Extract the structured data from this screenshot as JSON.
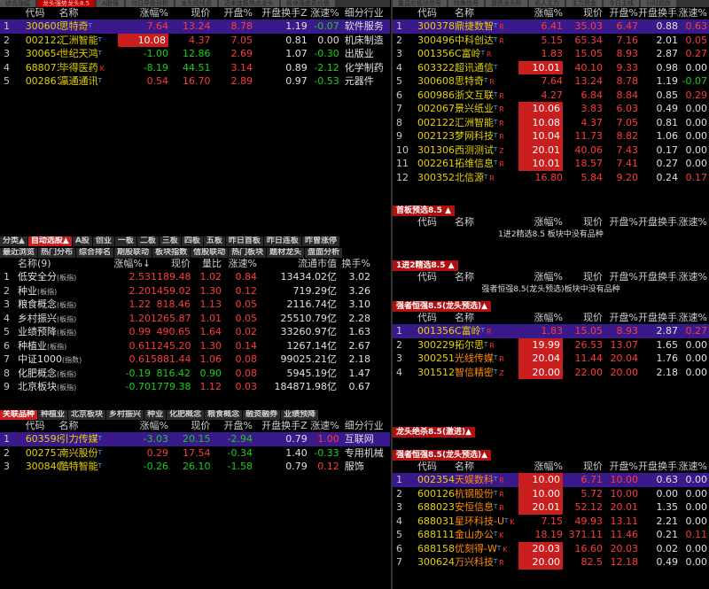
{
  "top_tabs_left": [
    "综合涨幅",
    "龙头强势龙头8.5",
    "A股强",
    "乌日早盘分析",
    "龙头短线盘",
    "近来连板热点龙头",
    "板块强盛竞价盘"
  ],
  "top_tabs_right": [
    "量益应板块信号",
    "特殊信号",
    "游资龙头阶",
    "毛人主力",
    "主力资金",
    "今日主线",
    "分时超跌"
  ],
  "hdr_main": {
    "code": "代码",
    "name": "名称",
    "chg": "涨幅%",
    "price": "现价",
    "open": "开盘%",
    "turn": "开盘换手Z",
    "spd": "涨速%",
    "ind": "细分行业"
  },
  "tl_rows": [
    {
      "i": "1",
      "code": "300608",
      "name": "思特奇",
      "chg": "7.64",
      "price": "13.24",
      "open": "8.78",
      "turn": "1.19",
      "spd": "-0.07",
      "ind": "软件服务",
      "sel": true
    },
    {
      "i": "2",
      "code": "002122",
      "name": "汇洲智能",
      "chg": "10.08",
      "price": "4.37",
      "open": "7.05",
      "turn": "0.81",
      "spd": "0.00",
      "ind": "机床制造",
      "hl": true
    },
    {
      "i": "3",
      "code": "300654",
      "name": "世纪天鸿",
      "chg": "-1.00",
      "price": "12.86",
      "open": "2.69",
      "turn": "1.07",
      "spd": "-0.30",
      "ind": "出版业"
    },
    {
      "i": "4",
      "code": "688073",
      "name": "毕得医药",
      "chg": "-8.19",
      "price": "44.51",
      "open": "3.14",
      "turn": "0.89",
      "spd": "-2.12",
      "ind": "化学制药",
      "tag": "K"
    },
    {
      "i": "5",
      "code": "002861",
      "name": "瀛通通讯",
      "chg": "0.54",
      "price": "16.70",
      "open": "2.89",
      "turn": "0.97",
      "spd": "-0.53",
      "ind": "元器件"
    }
  ],
  "tr_rows": [
    {
      "i": "1",
      "code": "300378",
      "name": "鼎捷数智",
      "tag": "R",
      "chg": "6.41",
      "price": "35.03",
      "open": "6.47",
      "turn": "0.88",
      "spd": "0.63",
      "sel": true
    },
    {
      "i": "2",
      "code": "300496",
      "name": "中科创达",
      "tag": "R",
      "chg": "5.15",
      "price": "65.34",
      "open": "7.16",
      "turn": "2.01",
      "spd": "0.05"
    },
    {
      "i": "3",
      "code": "001356",
      "name": "C富岭",
      "tag": "R",
      "chg": "1.83",
      "price": "15.05",
      "open": "8.93",
      "turn": "2.87",
      "spd": "0.27"
    },
    {
      "i": "4",
      "code": "603322",
      "name": "超讯通信",
      "tag": "",
      "chg": "10.01",
      "price": "40.10",
      "open": "9.33",
      "turn": "0.98",
      "spd": "0.00",
      "hl": true
    },
    {
      "i": "5",
      "code": "300608",
      "name": "思特奇",
      "tag": "R",
      "chg": "7.64",
      "price": "13.24",
      "open": "8.78",
      "turn": "1.19",
      "spd": "-0.07"
    },
    {
      "i": "6",
      "code": "600986",
      "name": "浙文互联",
      "tag": "R",
      "chg": "4.27",
      "price": "6.84",
      "open": "8.84",
      "turn": "0.85",
      "spd": "0.29"
    },
    {
      "i": "7",
      "code": "002067",
      "name": "景兴纸业",
      "tag": "R",
      "chg": "10.06",
      "price": "3.83",
      "open": "6.03",
      "turn": "0.49",
      "spd": "0.00",
      "hl": true
    },
    {
      "i": "8",
      "code": "002122",
      "name": "汇洲智能",
      "tag": "R",
      "chg": "10.08",
      "price": "4.37",
      "open": "7.05",
      "turn": "0.81",
      "spd": "0.00",
      "hl": true
    },
    {
      "i": "9",
      "code": "002123",
      "name": "梦网科技",
      "tag": "R",
      "chg": "10.04",
      "price": "11.73",
      "open": "8.82",
      "turn": "1.06",
      "spd": "0.00",
      "hl": true
    },
    {
      "i": "10",
      "code": "301306",
      "name": "西测测试",
      "tag": "Z",
      "chg": "20.01",
      "price": "40.06",
      "open": "7.43",
      "turn": "0.17",
      "spd": "0.00",
      "hl": true
    },
    {
      "i": "11",
      "code": "002261",
      "name": "拓维信息",
      "tag": "R",
      "chg": "10.01",
      "price": "18.57",
      "open": "7.41",
      "turn": "0.27",
      "spd": "0.00",
      "hl": true
    },
    {
      "i": "12",
      "code": "300352",
      "name": "北信源",
      "tag": "R",
      "chg": "16.80",
      "price": "5.84",
      "open": "9.20",
      "turn": "0.24",
      "spd": "0.17"
    }
  ],
  "mid_tabs_1": [
    "分类▲",
    "自动选股▲",
    "A股",
    "创业",
    "一板",
    "二板",
    "三板",
    "四板",
    "五板",
    "昨日首板",
    "昨日连板",
    "昨曾涨停"
  ],
  "mid_tabs_2": [
    "最近浏览",
    "热门分布",
    "综合排名",
    "期股联动",
    "板块指数",
    "信股联动",
    "热门板块",
    "题材龙头",
    "盘面分析"
  ],
  "sector_hdr": {
    "name": "名称(9)",
    "chg": "涨幅%↓",
    "price": "现价",
    "vr": "量比",
    "spd": "涨速%",
    "mv": "流通市值",
    "turn": "换手%"
  },
  "sector_rows": [
    {
      "i": "1",
      "name": "低安全分",
      "sub": "(板指)",
      "chg": "2.53",
      "price": "1189.48",
      "vr": "1.02",
      "spd": "0.84",
      "mv": "13434.02亿",
      "turn": "3.02"
    },
    {
      "i": "2",
      "name": "种业",
      "sub": "(板指)",
      "chg": "2.20",
      "price": "1459.02",
      "vr": "1.30",
      "spd": "0.12",
      "mv": "719.29亿",
      "turn": "3.26"
    },
    {
      "i": "3",
      "name": "粮食概念",
      "sub": "(板指)",
      "chg": "1.22",
      "price": "818.46",
      "vr": "1.13",
      "spd": "0.05",
      "mv": "2116.74亿",
      "turn": "3.10"
    },
    {
      "i": "4",
      "name": "乡村振兴",
      "sub": "(板指)",
      "chg": "1.20",
      "price": "1265.87",
      "vr": "1.01",
      "spd": "0.05",
      "mv": "25510.79亿",
      "turn": "2.28"
    },
    {
      "i": "5",
      "name": "业绩预降",
      "sub": "(板指)",
      "chg": "0.99",
      "price": "490.65",
      "vr": "1.64",
      "spd": "0.02",
      "mv": "33260.97亿",
      "turn": "1.63"
    },
    {
      "i": "6",
      "name": "种植业",
      "sub": "(板指)",
      "chg": "0.61",
      "price": "1245.20",
      "vr": "1.30",
      "spd": "0.14",
      "mv": "1267.14亿",
      "turn": "2.67"
    },
    {
      "i": "7",
      "name": "中证1000",
      "sub": "(指数)",
      "chg": "0.61",
      "price": "5881.44",
      "vr": "1.06",
      "spd": "0.08",
      "mv": "99025.21亿",
      "turn": "2.18"
    },
    {
      "i": "8",
      "name": "化肥概念",
      "sub": "(板指)",
      "chg": "-0.19",
      "price": "816.42",
      "vr": "0.90",
      "spd": "0.08",
      "mv": "5945.19亿",
      "turn": "1.47"
    },
    {
      "i": "9",
      "name": "北京板块",
      "sub": "(板指)",
      "chg": "-0.70",
      "price": "1779.38",
      "vr": "1.12",
      "spd": "0.03",
      "mv": "184871.98亿",
      "turn": "0.67"
    }
  ],
  "rel_tabs": [
    "关联品种",
    "种植业",
    "北京板块",
    "乡村振兴",
    "种业",
    "化肥概念",
    "粮食概念",
    "融资融券",
    "业绩预降"
  ],
  "rel_rows": [
    {
      "i": "1",
      "code": "603598",
      "name": "引力传媒",
      "chg": "-3.03",
      "price": "20.15",
      "open": "-2.94",
      "turn": "0.79",
      "spd": "1.00",
      "ind": "互联网",
      "sel": true
    },
    {
      "i": "2",
      "code": "002757",
      "name": "南兴股份",
      "chg": "0.29",
      "price": "17.54",
      "open": "-0.34",
      "turn": "1.40",
      "spd": "-0.33",
      "ind": "专用机械"
    },
    {
      "i": "3",
      "code": "300840",
      "name": "酷特智能",
      "chg": "-0.26",
      "price": "26.10",
      "open": "-1.58",
      "turn": "0.79",
      "spd": "0.12",
      "ind": "服饰"
    }
  ],
  "sect1": {
    "title": "首板预选8.5 ▲",
    "note": "1进2精选8.5 板块中没有品种"
  },
  "sect2": {
    "title": "1进2精选8.5 ▲",
    "note": "强者恒强8.5(龙头预选)板块中没有品种"
  },
  "sect3": {
    "title": "强者恒强8.5(龙头预选)▲"
  },
  "s3_rows": [
    {
      "i": "1",
      "code": "001356",
      "name": "C富岭",
      "tag": "R",
      "chg": "1.83",
      "price": "15.05",
      "open": "8.93",
      "turn": "2.87",
      "spd": "0.27",
      "sel": true
    },
    {
      "i": "2",
      "code": "300229",
      "name": "拓尔思",
      "tag": "R",
      "chg": "19.99",
      "price": "26.53",
      "open": "13.07",
      "turn": "1.65",
      "spd": "0.00",
      "hl": true
    },
    {
      "i": "3",
      "code": "300251",
      "name": "光线传媒",
      "tag": "R",
      "chg": "20.04",
      "price": "11.44",
      "open": "20.04",
      "turn": "1.76",
      "spd": "0.00",
      "hl": true,
      "org": true
    },
    {
      "i": "4",
      "code": "301512",
      "name": "智信精密",
      "tag": "Z",
      "chg": "20.00",
      "price": "22.00",
      "open": "20.00",
      "turn": "2.18",
      "spd": "0.00",
      "hl": true,
      "org": true
    }
  ],
  "sect4": {
    "title": "龙头绝杀8.5(激进)▲"
  },
  "sect5": {
    "title": "强者恒强8.5(龙头预选)▲"
  },
  "s5_rows": [
    {
      "i": "1",
      "code": "002354",
      "name": "天娱数科",
      "tag": "R",
      "chg": "10.00",
      "price": "6.71",
      "open": "10.00",
      "turn": "0.63",
      "spd": "0.00",
      "hl": true,
      "sel": true,
      "org": true
    },
    {
      "i": "2",
      "code": "600126",
      "name": "杭钢股份",
      "tag": "R",
      "chg": "10.00",
      "price": "5.72",
      "open": "10.00",
      "turn": "0.00",
      "spd": "0.00",
      "hl": true,
      "org": true
    },
    {
      "i": "3",
      "code": "688023",
      "name": "安恒信息",
      "tag": "R",
      "chg": "20.01",
      "price": "52.12",
      "open": "20.01",
      "turn": "1.35",
      "spd": "0.00",
      "hl": true,
      "org": true
    },
    {
      "i": "4",
      "code": "688031",
      "name": "星环科技-U",
      "tag": "K",
      "chg": "7.15",
      "price": "49.93",
      "open": "13.11",
      "turn": "2.21",
      "spd": "0.00",
      "org": true
    },
    {
      "i": "5",
      "code": "688111",
      "name": "金山办公",
      "tag": "K",
      "chg": "18.19",
      "price": "371.11",
      "open": "11.46",
      "turn": "0.21",
      "spd": "0.11",
      "org": true
    },
    {
      "i": "6",
      "code": "688158",
      "name": "优刻得-W",
      "tag": "K",
      "chg": "20.03",
      "price": "16.60",
      "open": "20.03",
      "turn": "0.02",
      "spd": "0.00",
      "hl": true,
      "org": true
    },
    {
      "i": "7",
      "code": "300624",
      "name": "万兴科技",
      "tag": "R",
      "chg": "20.00",
      "price": "82.5",
      "open": "12.18",
      "turn": "0.49",
      "spd": "0.00",
      "hl": true,
      "org": true
    }
  ]
}
